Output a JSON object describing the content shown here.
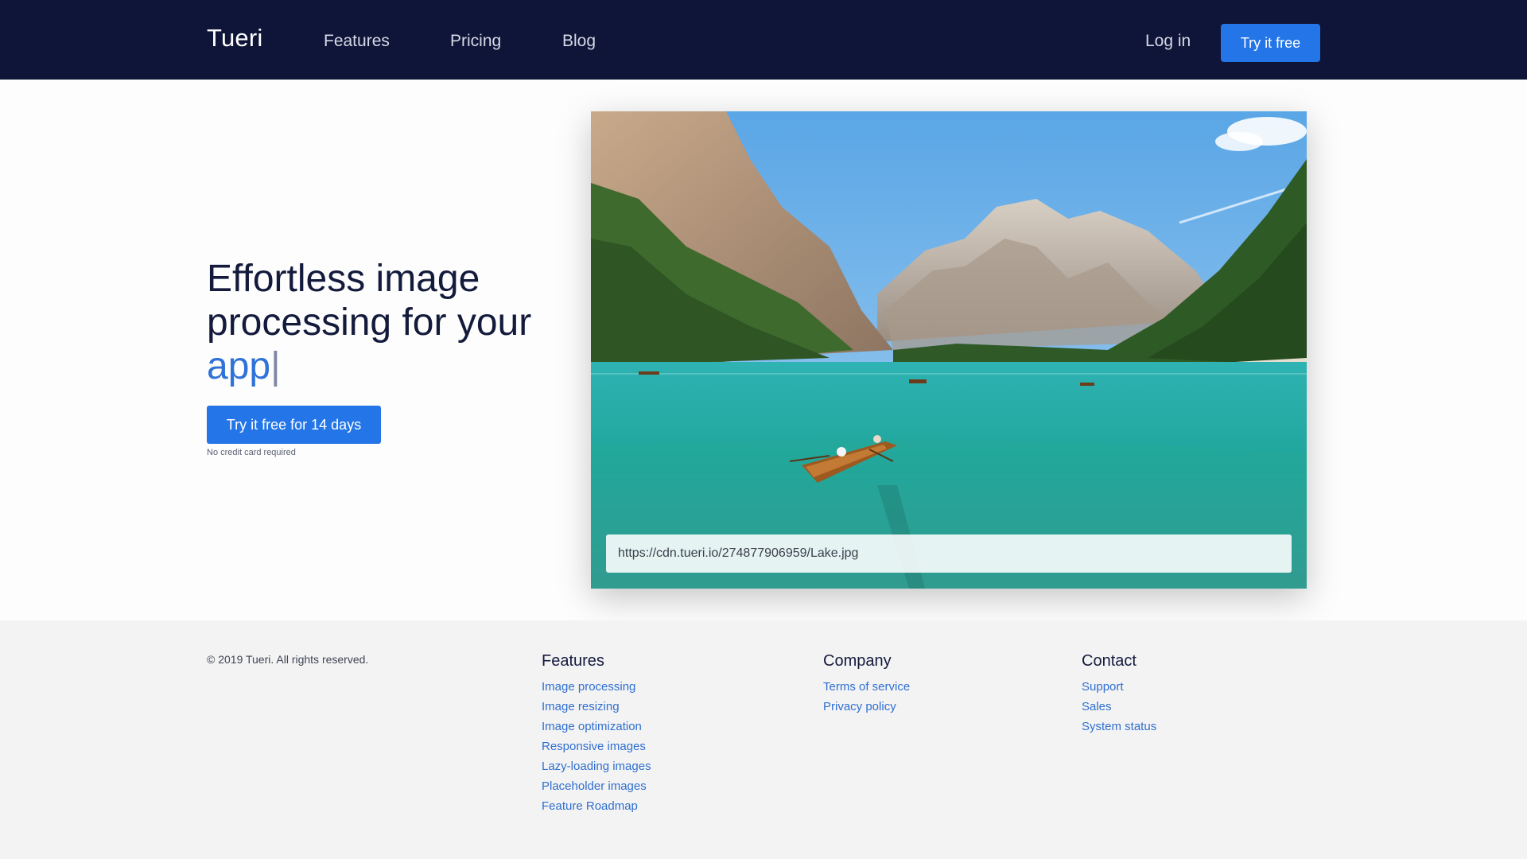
{
  "nav": {
    "brand": "Tueri",
    "links": [
      "Features",
      "Pricing",
      "Blog"
    ],
    "login": "Log in",
    "cta": "Try it free"
  },
  "hero": {
    "headline_1": "Effortless image",
    "headline_2": "processing for your",
    "headline_accent": "app",
    "caret": "|",
    "cta": "Try it free for 14 days",
    "note": "No credit card required",
    "url_value": "https://cdn.tueri.io/274877906959/Lake.jpg"
  },
  "footer": {
    "copyright": "© 2019 Tueri. All rights reserved.",
    "columns": [
      {
        "title": "Features",
        "links": [
          "Image processing",
          "Image resizing",
          "Image optimization",
          "Responsive images",
          "Lazy-loading images",
          "Placeholder images",
          "Feature Roadmap"
        ]
      },
      {
        "title": "Company",
        "links": [
          "Terms of service",
          "Privacy policy"
        ]
      },
      {
        "title": "Contact",
        "links": [
          "Support",
          "Sales",
          "System status"
        ]
      }
    ]
  },
  "colors": {
    "nav_bg": "#0f1538",
    "accent": "#2476e8",
    "headline_accent": "#2f72d8",
    "footer_bg": "#f3f3f4",
    "link": "#2f6fcf"
  }
}
